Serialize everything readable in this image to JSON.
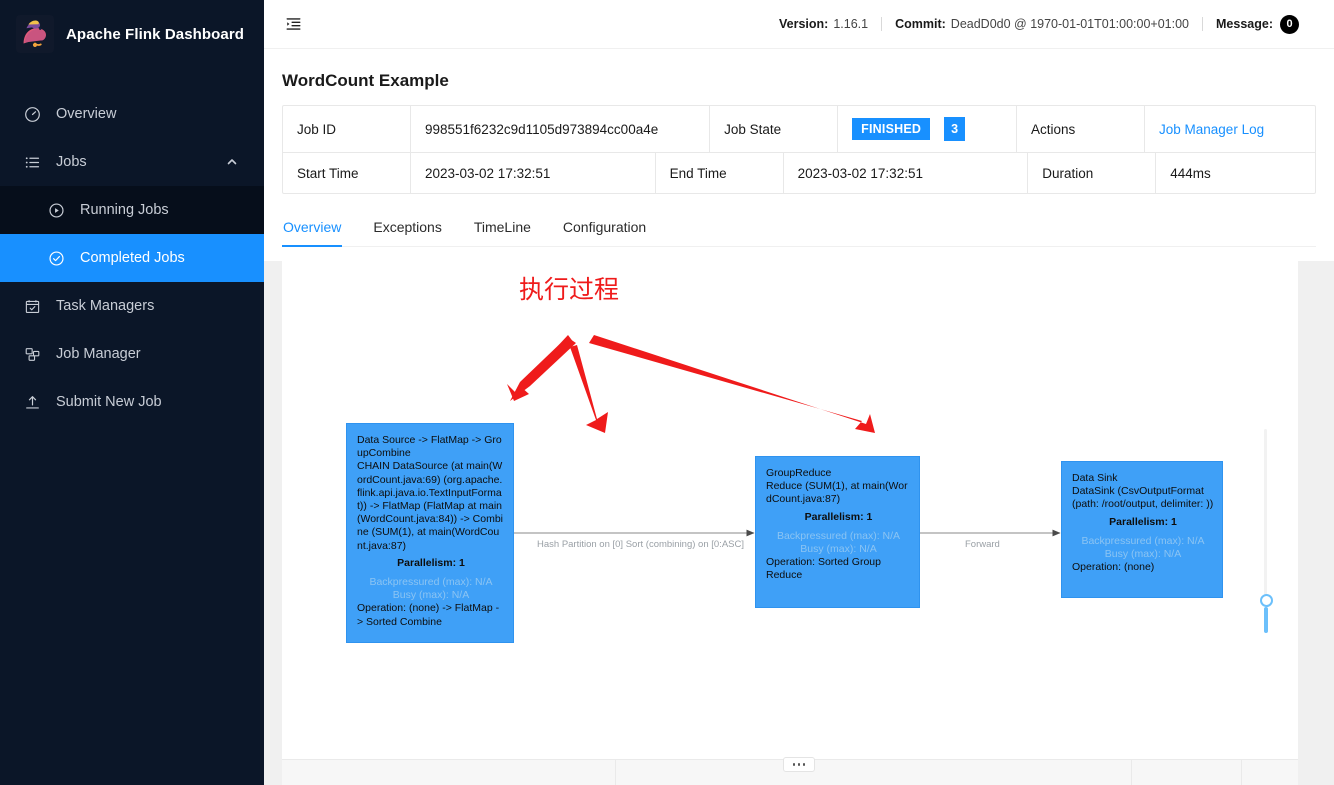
{
  "sidebar": {
    "brand": "Apache Flink Dashboard",
    "items": [
      {
        "label": "Overview",
        "icon": "dashboard-icon",
        "active": false
      },
      {
        "label": "Jobs",
        "icon": "list-icon",
        "active": false,
        "expanded": true
      },
      {
        "label": "Running Jobs",
        "icon": "play-circle-icon",
        "active": false,
        "sub": true
      },
      {
        "label": "Completed Jobs",
        "icon": "check-circle-icon",
        "active": true,
        "sub": true
      },
      {
        "label": "Task Managers",
        "icon": "task-manager-icon",
        "active": false
      },
      {
        "label": "Job Manager",
        "icon": "job-manager-icon",
        "active": false
      },
      {
        "label": "Submit New Job",
        "icon": "upload-icon",
        "active": false
      }
    ]
  },
  "topbar": {
    "fold_icon": "menu-fold-icon",
    "version_key": "Version:",
    "version_value": "1.16.1",
    "commit_key": "Commit:",
    "commit_value": "DeadD0d0 @ 1970-01-01T01:00:00+01:00",
    "message_key": "Message:",
    "message_count": "0"
  },
  "job": {
    "title": "WordCount Example",
    "rows": [
      {
        "label1": "Job ID",
        "value1": "998551f6232c9d1105d973894cc00a4e",
        "label2": "Job State",
        "state": "FINISHED",
        "state_count": "3",
        "label3": "Actions",
        "action_link": "Job Manager Log"
      },
      {
        "label1": "Start Time",
        "value1": "2023-03-02 17:32:51",
        "label2": "End Time",
        "value2": "2023-03-02 17:32:51",
        "label3": "Duration",
        "value3": "444ms"
      }
    ]
  },
  "tabs": [
    {
      "label": "Overview",
      "active": true
    },
    {
      "label": "Exceptions",
      "active": false
    },
    {
      "label": "TimeLine",
      "active": false
    },
    {
      "label": "Configuration",
      "active": false
    }
  ],
  "graph": {
    "nodes": [
      {
        "name": "Data Source -> FlatMap -> GroupCombine",
        "detail": "CHAIN DataSource (at main(WordCount.java:69) (org.apache.flink.api.java.io.TextInputFormat)) -> FlatMap (FlatMap at main(WordCount.java:84)) -> Combine (SUM(1), at main(WordCount.java:87)",
        "parallelism": "Parallelism: 1",
        "backpressured": "Backpressured (max): N/A",
        "busy": "Busy (max): N/A",
        "operation": "Operation: (none) -> FlatMap -> Sorted Combine"
      },
      {
        "name": "GroupReduce",
        "detail": "Reduce (SUM(1), at main(WordCount.java:87)",
        "parallelism": "Parallelism: 1",
        "backpressured": "Backpressured (max): N/A",
        "busy": "Busy (max): N/A",
        "operation": "Operation: Sorted Group Reduce"
      },
      {
        "name": "Data Sink",
        "detail": "DataSink (CsvOutputFormat (path: /root/output, delimiter: ))",
        "parallelism": "Parallelism: 1",
        "backpressured": "Backpressured (max): N/A",
        "busy": "Busy (max): N/A",
        "operation": "Operation: (none)"
      }
    ],
    "edges": [
      {
        "label": "Hash Partition on [0] Sort (combining) on [0:ASC]"
      },
      {
        "label": "Forward"
      }
    ],
    "node_color": "#3fa0f7",
    "annotation": {
      "text": "执行过程",
      "color": "#ef1b1b"
    }
  }
}
